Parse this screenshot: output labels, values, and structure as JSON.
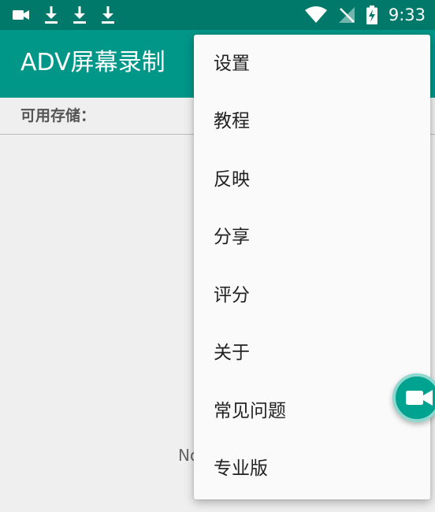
{
  "status_bar": {
    "time": "9:33",
    "icons": [
      "video-record-icon",
      "download-icon",
      "download-icon",
      "download-icon",
      "wifi-icon",
      "no-signal-icon",
      "battery-charging-icon"
    ]
  },
  "app_bar": {
    "title": "ADV屏幕录制"
  },
  "storage": {
    "label": "可用存储："
  },
  "main": {
    "empty_text_partial": "No"
  },
  "overflow_menu": {
    "items": [
      {
        "label": "设置"
      },
      {
        "label": "教程"
      },
      {
        "label": "反映"
      },
      {
        "label": "分享"
      },
      {
        "label": "评分"
      },
      {
        "label": "关于"
      },
      {
        "label": "常见问题"
      },
      {
        "label": "专业版"
      }
    ]
  },
  "fab": {
    "icon": "video-camera-icon"
  },
  "colors": {
    "status_bar": "#00796b",
    "app_bar": "#009688",
    "fab": "#00a38f",
    "background": "#efefef",
    "menu_background": "#fafafa"
  }
}
